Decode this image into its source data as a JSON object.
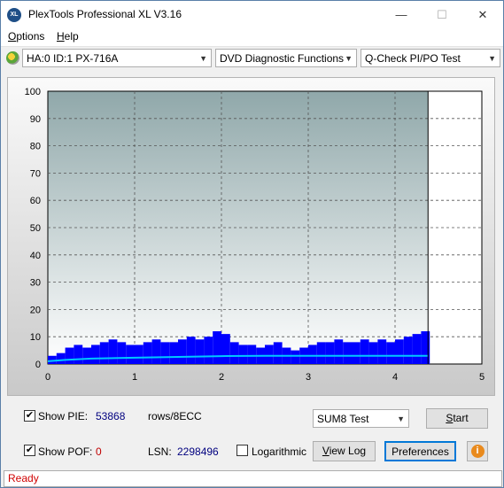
{
  "window": {
    "title": "PlexTools Professional XL V3.16",
    "icon_text": "XL"
  },
  "window_controls": {
    "minimize": "—",
    "maximize": "☐",
    "close": "✕"
  },
  "menu": {
    "options": "ptions",
    "options_key": "O",
    "help": "elp",
    "help_key": "H"
  },
  "toolbar": {
    "drive": "HA:0 ID:1  PX-716A",
    "function": "DVD Diagnostic Functions",
    "test": "Q-Check PI/PO Test"
  },
  "chart_data": {
    "type": "bar",
    "title": "",
    "xlabel": "",
    "ylabel": "",
    "xlim": [
      0,
      5
    ],
    "ylim": [
      0,
      100
    ],
    "x_ticks": [
      "0",
      "1",
      "2",
      "3",
      "4",
      "5"
    ],
    "y_ticks": [
      "0",
      "10",
      "20",
      "30",
      "40",
      "50",
      "60",
      "70",
      "80",
      "90",
      "100"
    ],
    "grid": true,
    "data_end_x": 4.38,
    "marker_x": 4.38,
    "series": [
      {
        "kind": "bars",
        "color": "#0000ff",
        "x": [
          0.05,
          0.15,
          0.25,
          0.35,
          0.45,
          0.55,
          0.65,
          0.75,
          0.85,
          0.95,
          1.05,
          1.15,
          1.25,
          1.35,
          1.45,
          1.55,
          1.65,
          1.75,
          1.85,
          1.95,
          2.05,
          2.15,
          2.25,
          2.35,
          2.45,
          2.55,
          2.65,
          2.75,
          2.85,
          2.95,
          3.05,
          3.15,
          3.25,
          3.35,
          3.45,
          3.55,
          3.65,
          3.75,
          3.85,
          3.95,
          4.05,
          4.15,
          4.25,
          4.35
        ],
        "values": [
          3,
          4,
          6,
          7,
          6,
          7,
          8,
          9,
          8,
          7,
          7,
          8,
          9,
          8,
          8,
          9,
          10,
          9,
          10,
          12,
          11,
          8,
          7,
          7,
          6,
          7,
          8,
          6,
          5,
          6,
          7,
          8,
          8,
          9,
          8,
          8,
          9,
          8,
          9,
          8,
          9,
          10,
          11,
          12
        ]
      },
      {
        "kind": "line",
        "color": "#00c8ff",
        "x": [
          0,
          0.2,
          0.5,
          1.0,
          1.5,
          2.0,
          2.5,
          3.0,
          3.5,
          4.0,
          4.38
        ],
        "values": [
          1,
          1.5,
          2,
          2.3,
          2.6,
          2.9,
          3.0,
          3.0,
          3.0,
          3.0,
          3.0
        ]
      }
    ]
  },
  "controls": {
    "show_pie_label": "Show PIE:",
    "show_pie_checked": "✔",
    "pie_value": "53868",
    "pie_unit": "rows/8ECC",
    "show_pof_label": "Show POF:",
    "show_pof_checked": "✔",
    "pof_value": "0",
    "lsn_label": "LSN:",
    "lsn_value": "2298496",
    "logarithmic_label": "Logarithmic",
    "sum8_select": "SUM8 Test",
    "start_label": "tart",
    "start_key": "S",
    "viewlog_label": "iew Log",
    "viewlog_key": "V",
    "preferences_label": "Preferences",
    "info_icon": "i"
  },
  "status": {
    "text": "Ready",
    "color": "#d00000"
  },
  "colors": {
    "pie_value": "#00007f",
    "pof_value": "#c00000",
    "pi_bars": "#0000ff",
    "pi_avg_line": "#00c8ff"
  }
}
